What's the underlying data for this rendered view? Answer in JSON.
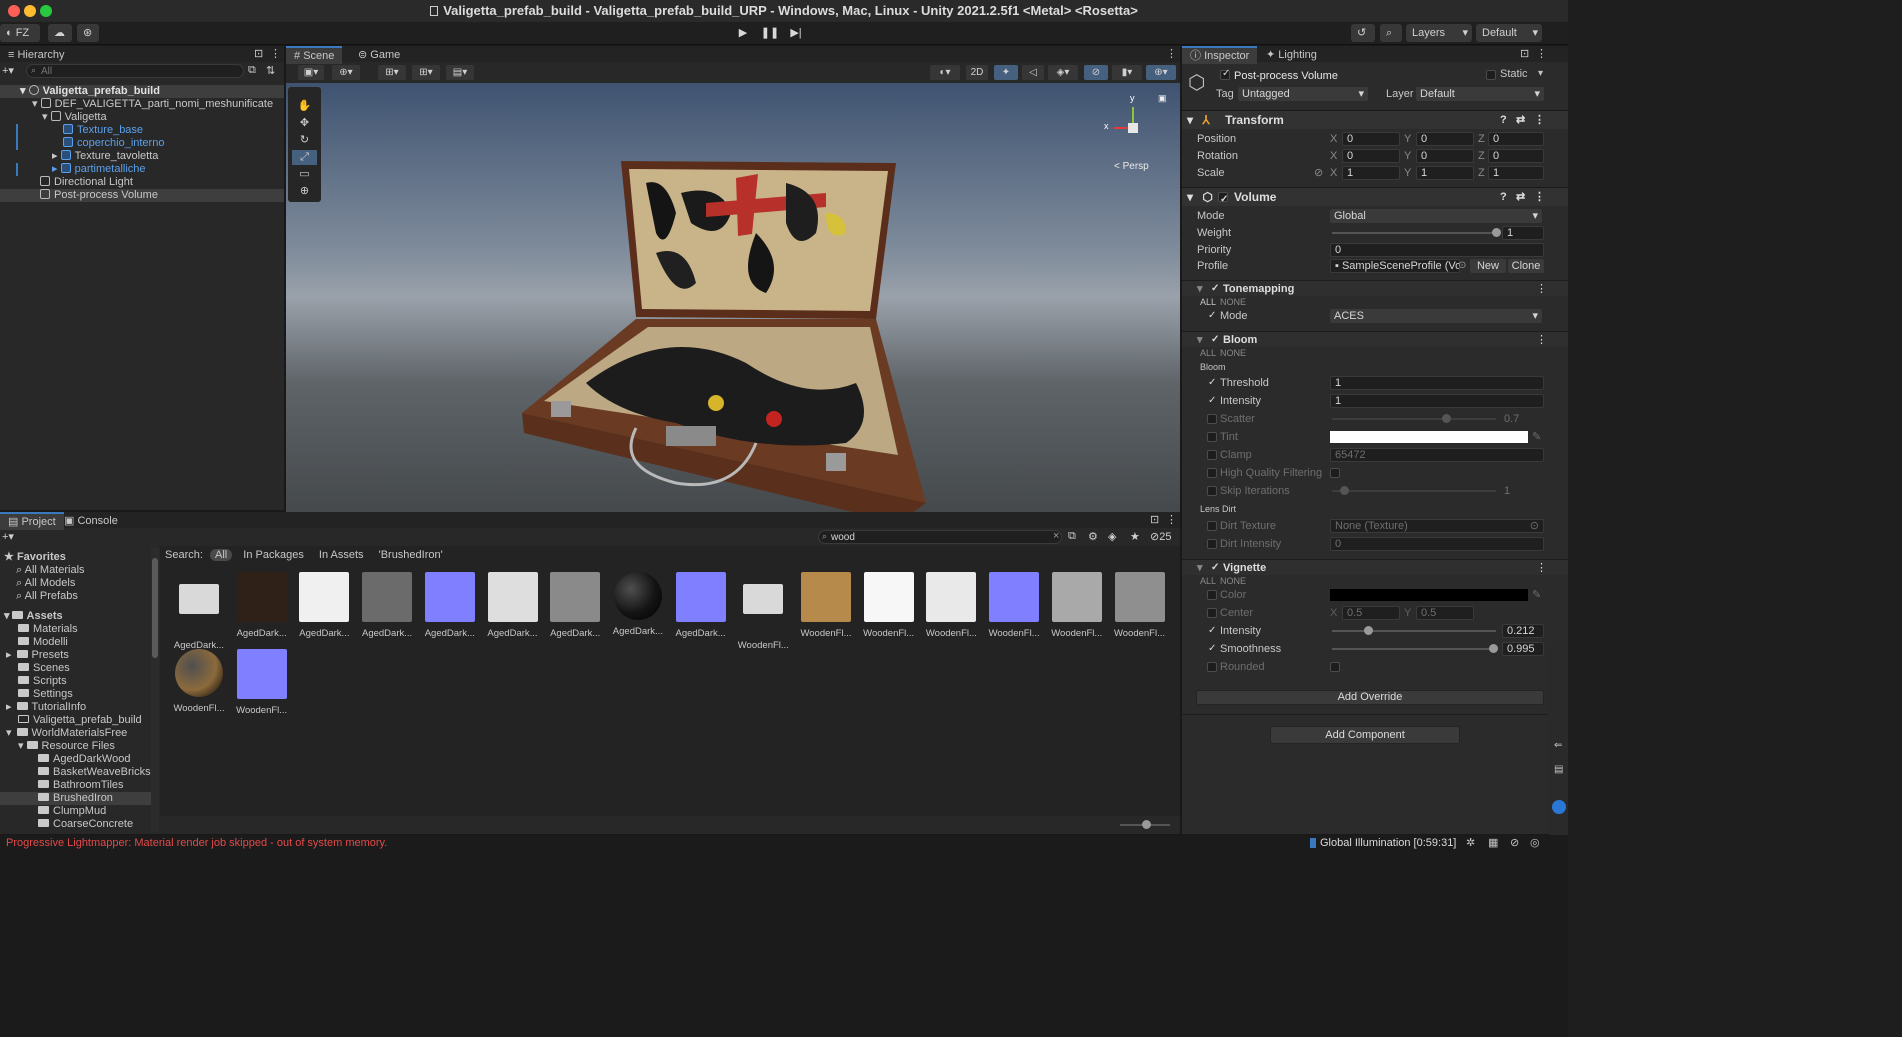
{
  "window": {
    "title": "Valigetta_prefab_build - Valigetta_prefab_build_URP - Windows, Mac, Linux - Unity 2021.2.5f1 <Metal> <Rosetta>"
  },
  "toolbar": {
    "account": "FZ",
    "layers_label": "Layers",
    "layout_label": "Default"
  },
  "hierarchy": {
    "tab": "Hierarchy",
    "search_placeholder": "All",
    "items": [
      {
        "label": "Valigetta_prefab_build"
      },
      {
        "label": "DEF_VALIGETTA_parti_nomi_meshunificate"
      },
      {
        "label": "Valigetta"
      },
      {
        "label": "Texture_base"
      },
      {
        "label": "coperchio_interno"
      },
      {
        "label": "Texture_tavoletta"
      },
      {
        "label": "partimetalliche"
      },
      {
        "label": "Directional Light"
      },
      {
        "label": "Post-process Volume"
      }
    ]
  },
  "scene": {
    "tabs": [
      "Scene",
      "Game"
    ],
    "mode_2d": "2D",
    "persp_label": "< Persp",
    "gizmo": {
      "x": "x",
      "y": "y"
    }
  },
  "project": {
    "tabs": [
      "Project",
      "Console"
    ],
    "search_value": "wood",
    "count": "25",
    "search_filter": {
      "label": "Search:",
      "options": [
        "All",
        "In Packages",
        "In Assets",
        "'BrushedIron'"
      ]
    },
    "favorites": {
      "title": "Favorites",
      "items": [
        "All Materials",
        "All Models",
        "All Prefabs"
      ]
    },
    "assets": {
      "title": "Assets",
      "items": [
        "Materials",
        "Modelli",
        "Presets",
        "Scenes",
        "Scripts",
        "Settings",
        "TutorialInfo",
        "Valigetta_prefab_build",
        "WorldMaterialsFree",
        "Resource Files",
        "AgedDarkWood",
        "BasketWeaveBricks",
        "BathroomTiles",
        "BrushedIron",
        "ClumpMud",
        "CoarseConcrete"
      ]
    },
    "grid": [
      {
        "label": "AgedDark...",
        "color": "#d9d9d9",
        "kind": "folder"
      },
      {
        "label": "AgedDark...",
        "color": "#2f2118",
        "kind": "tex"
      },
      {
        "label": "AgedDark...",
        "color": "#f0f0f0",
        "kind": "tex"
      },
      {
        "label": "AgedDark...",
        "color": "#6b6b6b",
        "kind": "tex"
      },
      {
        "label": "AgedDark...",
        "color": "#7f7fff",
        "kind": "tex"
      },
      {
        "label": "AgedDark...",
        "color": "#dedede",
        "kind": "tex"
      },
      {
        "label": "AgedDark...",
        "color": "#8a8a8a",
        "kind": "tex"
      },
      {
        "label": "AgedDark...",
        "color": "#141414",
        "kind": "sphere"
      },
      {
        "label": "AgedDark...",
        "color": "#7f7fff",
        "kind": "tex"
      },
      {
        "label": "WoodenFl...",
        "color": "#d9d9d9",
        "kind": "folder"
      },
      {
        "label": "WoodenFl...",
        "color": "#b58a4a",
        "kind": "tex"
      },
      {
        "label": "WoodenFl...",
        "color": "#f7f7f7",
        "kind": "tex"
      },
      {
        "label": "WoodenFl...",
        "color": "#e9e9e9",
        "kind": "tex"
      },
      {
        "label": "WoodenFl...",
        "color": "#7f7fff",
        "kind": "tex"
      },
      {
        "label": "WoodenFl...",
        "color": "#a9a9a9",
        "kind": "tex"
      },
      {
        "label": "WoodenFl...",
        "color": "#8f8f8f",
        "kind": "tex"
      },
      {
        "label": "WoodenFl...",
        "color": "#8c6a3c",
        "kind": "sphere"
      },
      {
        "label": "WoodenFl...",
        "color": "#7f7fff",
        "kind": "tex"
      }
    ]
  },
  "inspector": {
    "tabs": [
      "Inspector",
      "Lighting"
    ],
    "object_name": "Post-process Volume",
    "static_label": "Static",
    "tag_label": "Tag",
    "tag_value": "Untagged",
    "layer_label": "Layer",
    "layer_value": "Default",
    "transform": {
      "title": "Transform",
      "rows": [
        {
          "label": "Position",
          "x": "0",
          "y": "0",
          "z": "0"
        },
        {
          "label": "Rotation",
          "x": "0",
          "y": "0",
          "z": "0"
        },
        {
          "label": "Scale",
          "x": "1",
          "y": "1",
          "z": "1"
        }
      ]
    },
    "volume": {
      "title": "Volume",
      "mode_label": "Mode",
      "mode_value": "Global",
      "weight_label": "Weight",
      "weight_value": "1",
      "priority_label": "Priority",
      "priority_value": "0",
      "profile_label": "Profile",
      "profile_value": "SampleSceneProfile (Vo",
      "new_label": "New",
      "clone_label": "Clone"
    },
    "all_label": "ALL",
    "none_label": "NONE",
    "tonemapping": {
      "title": "Tonemapping",
      "mode_label": "Mode",
      "mode_value": "ACES"
    },
    "bloom": {
      "title": "Bloom",
      "sub": "Bloom",
      "threshold_label": "Threshold",
      "threshold_value": "1",
      "intensity_label": "Intensity",
      "intensity_value": "1",
      "scatter_label": "Scatter",
      "scatter_value": "0.7",
      "tint_label": "Tint",
      "clamp_label": "Clamp",
      "clamp_value": "65472",
      "hq_label": "High Quality Filtering",
      "skip_label": "Skip Iterations",
      "skip_value": "1",
      "lensdirt": "Lens Dirt",
      "dirt_tex_label": "Dirt Texture",
      "dirt_tex_value": "None (Texture)",
      "dirt_int_label": "Dirt Intensity",
      "dirt_int_value": "0"
    },
    "vignette": {
      "title": "Vignette",
      "color_label": "Color",
      "center_label": "Center",
      "center_x": "0.5",
      "center_y": "0.5",
      "intensity_label": "Intensity",
      "intensity_value": "0.212",
      "smooth_label": "Smoothness",
      "smooth_value": "0.995",
      "rounded_label": "Rounded"
    },
    "add_override": "Add Override",
    "add_component": "Add Component"
  },
  "status": {
    "message": "Progressive Lightmapper: Material render job skipped - out of system memory.",
    "gi": "Global Illumination [0:59:31]"
  },
  "colors": {
    "accent": "#3a79bb",
    "error": "#e44a4a",
    "prefab": "#5aa0ea"
  }
}
